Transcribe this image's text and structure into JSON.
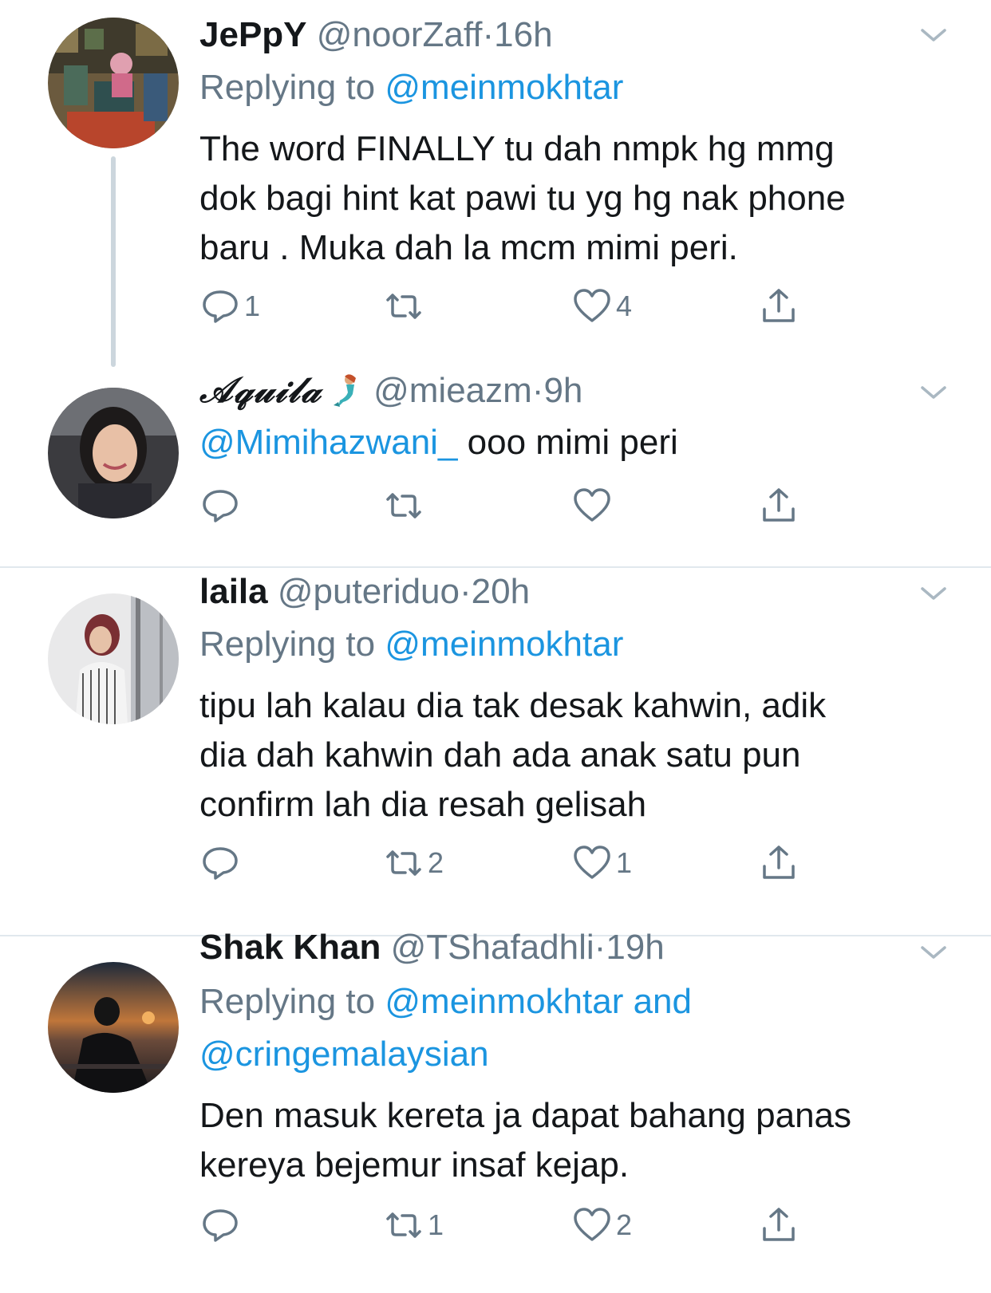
{
  "tweets": [
    {
      "display_name": "JePpY",
      "handle": "@noorZaff",
      "separator": "·",
      "time": "16h",
      "replying_prefix": "Replying to",
      "replying_to": "@meinmokhtar",
      "body_lines": [
        "The word FINALLY tu dah nmpk hg mmg",
        "dok bagi hint kat pawi tu yg hg nak phone",
        "baru . Muka dah la mcm mimi peri."
      ],
      "replies": "1",
      "retweets": "",
      "likes": "4"
    },
    {
      "display_name": "𝒜𝓆𝓊𝒾𝓁𝒶",
      "emoji": "mermaid-emoji",
      "handle": "@mieazm",
      "separator": "·",
      "time": "9h",
      "mention": "@Mimihazwani_",
      "body_rest": " ooo mimi peri",
      "replies": "",
      "retweets": "",
      "likes": ""
    },
    {
      "display_name": "laila",
      "handle": "@puteriduo",
      "separator": "·",
      "time": "20h",
      "replying_prefix": "Replying to",
      "replying_to": "@meinmokhtar",
      "body_lines": [
        "tipu lah kalau dia tak desak kahwin, adik",
        "dia dah kahwin dah ada anak satu pun",
        "confirm lah dia resah gelisah"
      ],
      "replies": "",
      "retweets": "2",
      "likes": "1"
    },
    {
      "display_name": "Shak Khan",
      "handle": "@TShafadhli",
      "separator": "·",
      "time": "19h",
      "replying_prefix": "Replying to",
      "replying_to_line1": "@meinmokhtar and",
      "replying_to_line2": "@cringemalaysian",
      "body_lines": [
        "Den masuk kereta ja dapat bahang panas",
        "kereya bejemur insaf kejap."
      ],
      "replies": "",
      "retweets": "1",
      "likes": "2"
    }
  ],
  "colors": {
    "text": "#14171a",
    "secondary": "#657786",
    "link": "#1b95e0",
    "divider": "#e1e8ed",
    "thread_line": "#ccd6dd"
  },
  "icons": [
    "reply-icon",
    "retweet-icon",
    "like-icon",
    "share-icon",
    "chevron-down-icon"
  ]
}
